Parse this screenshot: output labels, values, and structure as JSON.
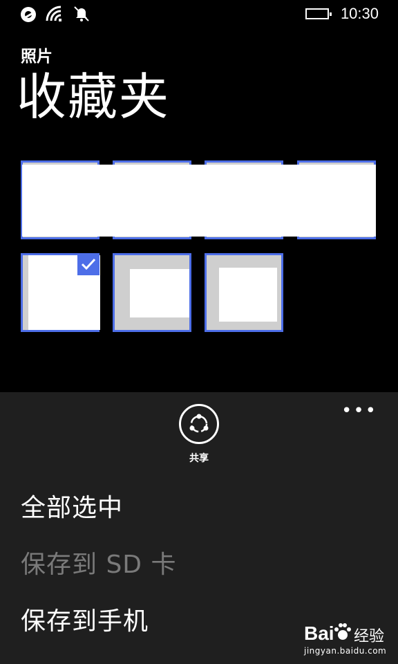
{
  "status_bar": {
    "time": "10:30",
    "icons": [
      "data-sense-icon",
      "wifi-icon",
      "bell-muted-icon",
      "battery-icon"
    ]
  },
  "header": {
    "app_name": "照片",
    "page_title": "收藏夹"
  },
  "photos": {
    "count": 7,
    "selected_index": 4
  },
  "app_bar": {
    "more_label": "•••",
    "share_label": "共享",
    "menu": [
      {
        "label": "全部选中",
        "enabled": true
      },
      {
        "label": "保存到 SD 卡",
        "enabled": false
      },
      {
        "label": "保存到手机",
        "enabled": true
      }
    ]
  },
  "watermark": {
    "logo": "Bai",
    "logo_suffix": "经验",
    "url": "jingyan.baidu.com"
  },
  "colors": {
    "accent": "#4d6ee8",
    "app_bar_bg": "#1f1f1f",
    "disabled_text": "#7a7a7a"
  }
}
